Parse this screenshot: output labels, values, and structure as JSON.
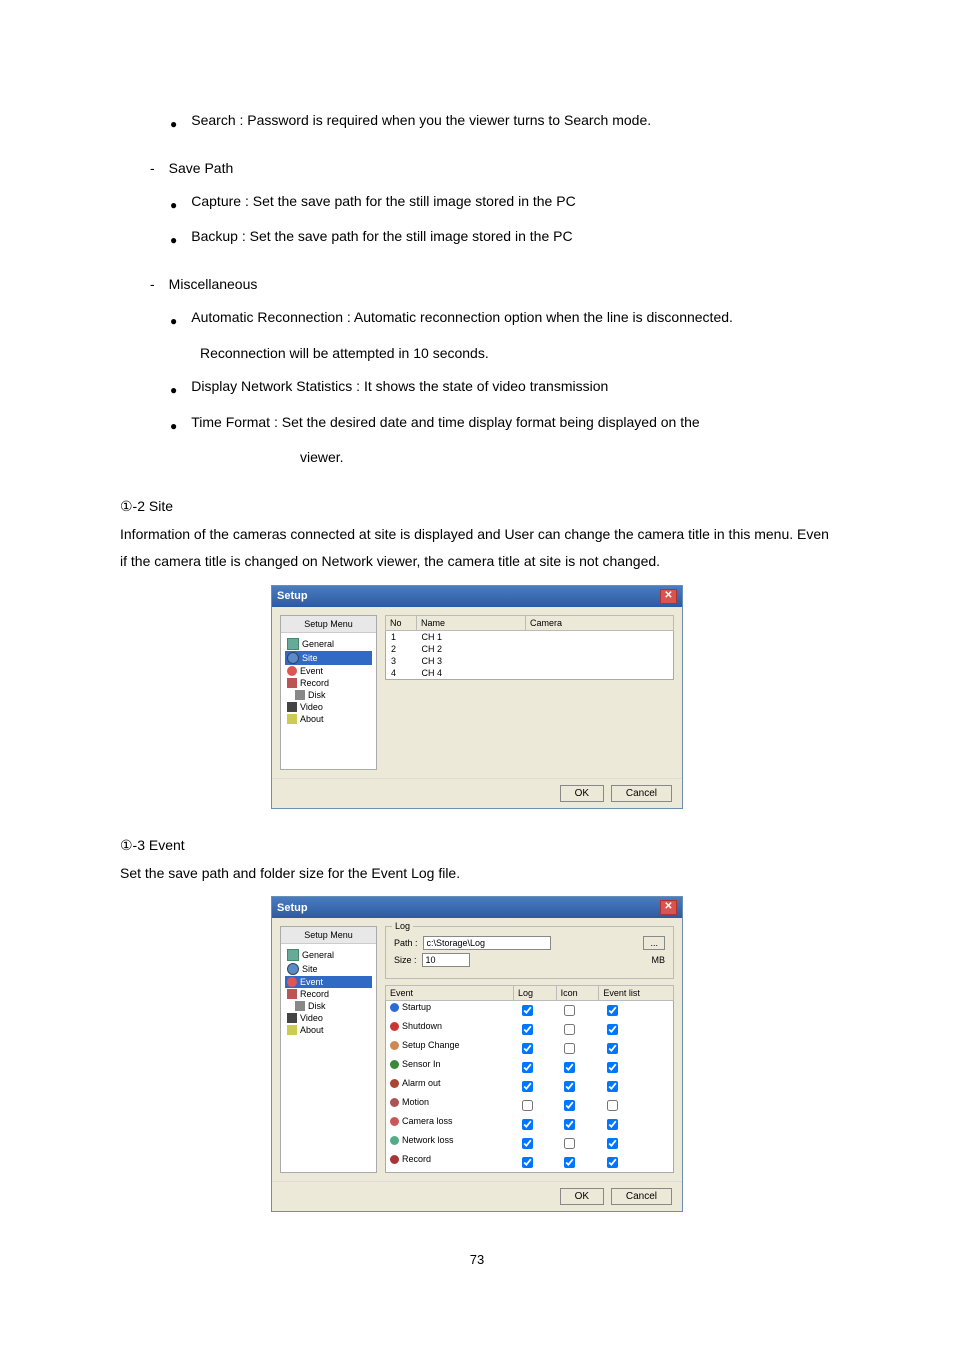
{
  "bullets_top": {
    "search": "Search : Password is required when you the viewer turns to Search mode."
  },
  "save_path": {
    "heading": "Save Path",
    "capture": "Capture : Set the save path for the still image stored in the PC",
    "backup": "Backup : Set the save path for the still image stored in the PC"
  },
  "misc": {
    "heading": "Miscellaneous",
    "auto1": "Automatic Reconnection : Automatic reconnection option when the line is disconnected.",
    "auto2": "Reconnection will be attempted in 10 seconds.",
    "display": "Display Network Statistics : It shows the state of video transmission",
    "time1": "Time Format : Set the desired date and time display format being displayed on the",
    "time2": "viewer."
  },
  "site": {
    "title": "①-2 Site",
    "desc": "Information of the cameras connected at site is displayed and User can change the camera title in this menu. Even if the camera title is changed on Network viewer, the camera title at site is not changed."
  },
  "event": {
    "title": "①-3 Event",
    "desc": "Set the save path and folder size for the Event Log file."
  },
  "dialog": {
    "title": "Setup",
    "tree_header": "Setup Menu",
    "tree_items": [
      "General",
      "Site",
      "Event",
      "Record",
      "Disk",
      "Video",
      "About"
    ],
    "site_cols": [
      "No",
      "Name",
      "Camera"
    ],
    "site_rows": [
      {
        "no": "1",
        "name": "CH 1",
        "camera": ""
      },
      {
        "no": "2",
        "name": "CH 2",
        "camera": ""
      },
      {
        "no": "3",
        "name": "CH 3",
        "camera": ""
      },
      {
        "no": "4",
        "name": "CH 4",
        "camera": ""
      }
    ],
    "ok": "OK",
    "cancel": "Cancel"
  },
  "event_dialog": {
    "log_label": "Log",
    "path_label": "Path :",
    "path_value": "c:\\Storage\\Log",
    "size_label": "Size :",
    "size_value": "10",
    "size_unit": "MB",
    "browse": "...",
    "cols": [
      "Event",
      "Log",
      "Icon",
      "Event list"
    ],
    "rows": [
      {
        "name": "Startup",
        "log": true,
        "icon": false,
        "list": true,
        "color": "#2a6bd4"
      },
      {
        "name": "Shutdown",
        "log": true,
        "icon": false,
        "list": true,
        "color": "#c33"
      },
      {
        "name": "Setup Change",
        "log": true,
        "icon": false,
        "list": true,
        "color": "#c85"
      },
      {
        "name": "Sensor In",
        "log": true,
        "icon": true,
        "list": true,
        "color": "#3a8a3a"
      },
      {
        "name": "Alarm out",
        "log": true,
        "icon": true,
        "list": true,
        "color": "#a43"
      },
      {
        "name": "Motion",
        "log": false,
        "icon": true,
        "list": false,
        "color": "#a55"
      },
      {
        "name": "Camera loss",
        "log": true,
        "icon": true,
        "list": true,
        "color": "#c55"
      },
      {
        "name": "Network loss",
        "log": true,
        "icon": false,
        "list": true,
        "color": "#5a8"
      },
      {
        "name": "Record",
        "log": true,
        "icon": true,
        "list": true,
        "color": "#a33"
      }
    ]
  },
  "page_number": "73"
}
